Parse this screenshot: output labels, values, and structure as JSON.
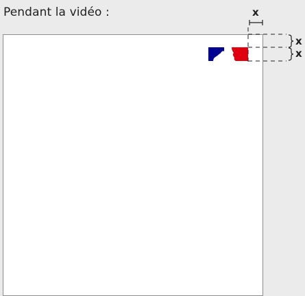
{
  "heading": "Pendant la vidéo :",
  "margin_marker": "x",
  "logo": {
    "name": "republique-francaise-flag-logo",
    "colors": {
      "blue": "#000091",
      "red": "#e1000f",
      "white": "#ffffff"
    }
  },
  "colors": {
    "page_background": "#ebebeb",
    "frame_background": "#ffffff",
    "frame_border": "#8c8c8c",
    "guide_lines": "#1f1f1f"
  }
}
